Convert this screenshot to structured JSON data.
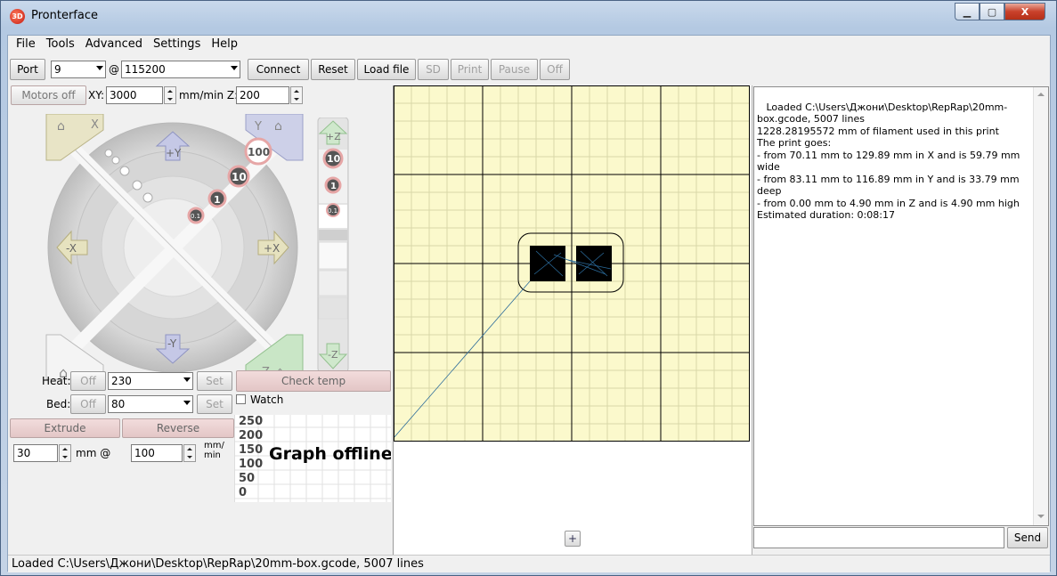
{
  "window": {
    "title": "Pronterface",
    "app_icon": "pronterface-icon",
    "minimize": "▁",
    "maximize": "▢",
    "close": "X"
  },
  "menu": [
    "File",
    "Tools",
    "Advanced",
    "Settings",
    "Help"
  ],
  "toolbar": {
    "port_label": "Port",
    "port_value": "9",
    "at": "@",
    "baud_value": "115200",
    "connect": "Connect",
    "reset": "Reset",
    "load_file": "Load file",
    "sd": "SD",
    "print": "Print",
    "pause": "Pause",
    "off": "Off"
  },
  "motion": {
    "motors_off": "Motors off",
    "xy_label": "XY:",
    "xy_value": "3000",
    "unit": "mm/min Z:",
    "z_value": "200"
  },
  "jog": {
    "home_x": "X",
    "home_y": "Y",
    "home_z": "Z",
    "plus_y": "+Y",
    "minus_y": "-Y",
    "plus_x": "+X",
    "minus_x": "-X",
    "steps": [
      "100",
      "10",
      "1",
      "0.1"
    ],
    "plus_z": "+Z",
    "minus_z": "-Z",
    "zsteps": [
      "10",
      "1",
      "0.1"
    ]
  },
  "temps": {
    "heat_label": "Heat:",
    "heat_off": "Off",
    "heat_value": "230",
    "heat_set": "Set",
    "bed_label": "Bed:",
    "bed_off": "Off",
    "bed_value": "80",
    "bed_set": "Set",
    "check_temp": "Check temp",
    "watch": "Watch"
  },
  "extrude": {
    "extrude": "Extrude",
    "reverse": "Reverse",
    "length": "30",
    "mm_at": "mm @",
    "speed": "100",
    "unit_top": "mm/",
    "unit_bottom": "min"
  },
  "graph": {
    "ticks": [
      "250",
      "200",
      "150",
      "100",
      "50",
      "0"
    ],
    "offline": "Graph offline"
  },
  "plate": {
    "add_button": "+",
    "bg": "#fbf9cc"
  },
  "console": {
    "text": "Loaded C:\\Users\\Джони\\Desktop\\RepRap\\20mm-box.gcode, 5007 lines\n1228.28195572 mm of filament used in this print\nThe print goes:\n- from 70.11 mm to 129.89 mm in X and is 59.79 mm wide\n- from 83.11 mm to 116.89 mm in Y and is 33.79 mm deep\n- from 0.00 mm to 4.90 mm in Z and is 4.90 mm high\nEstimated duration: 0:08:17",
    "send": "Send",
    "command": ""
  },
  "status": "Loaded C:\\Users\\Джони\\Desktop\\RepRap\\20mm-box.gcode, 5007 lines"
}
